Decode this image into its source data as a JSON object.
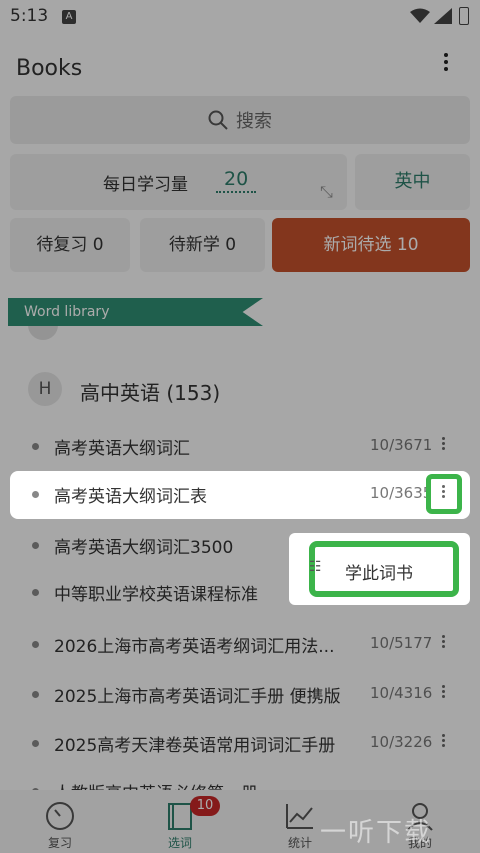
{
  "status_bar": {
    "time": "5:13",
    "notif_icon": "A"
  },
  "header": {
    "title": "Books"
  },
  "search": {
    "label": "搜索"
  },
  "daily": {
    "label": "每日学习量",
    "value": "20"
  },
  "lang_toggle": {
    "label": "英中"
  },
  "stats": [
    {
      "label": "待复习 0"
    },
    {
      "label": "待新学 0"
    },
    {
      "label": "新词待选 10"
    }
  ],
  "ribbon": {
    "label": "Word library"
  },
  "group": {
    "letter": "H",
    "title": "高中英语 (153)"
  },
  "books": [
    {
      "name": "高考英语大纲词汇",
      "count": "10/3671"
    },
    {
      "name": "高考英语大纲词汇表",
      "count": "10/3635"
    },
    {
      "name": "高考英语大纲词汇3500",
      "count": ""
    },
    {
      "name": "中等职业学校英语课程标准",
      "count": ""
    },
    {
      "name": "2026上海市高考英语考纲词汇用法...",
      "count": "10/5177"
    },
    {
      "name": "2025上海市高考英语词汇手册 便携版",
      "count": "10/4316"
    },
    {
      "name": "2025高考天津卷英语常用词词汇手册",
      "count": "10/3226"
    },
    {
      "name": "人教版高中英语必修第一册",
      "count": ""
    }
  ],
  "popup": {
    "item_label": "学此词书"
  },
  "nav": {
    "tabs": [
      {
        "label": "复习"
      },
      {
        "label": "选词"
      },
      {
        "label": "统计"
      },
      {
        "label": "我的"
      }
    ],
    "badge": "10"
  },
  "watermark": "一听下载",
  "colors": {
    "accent": "#2e7d6a",
    "primary_button": "#c4512c",
    "highlight": "#3cb44a",
    "badge": "#c72828"
  }
}
